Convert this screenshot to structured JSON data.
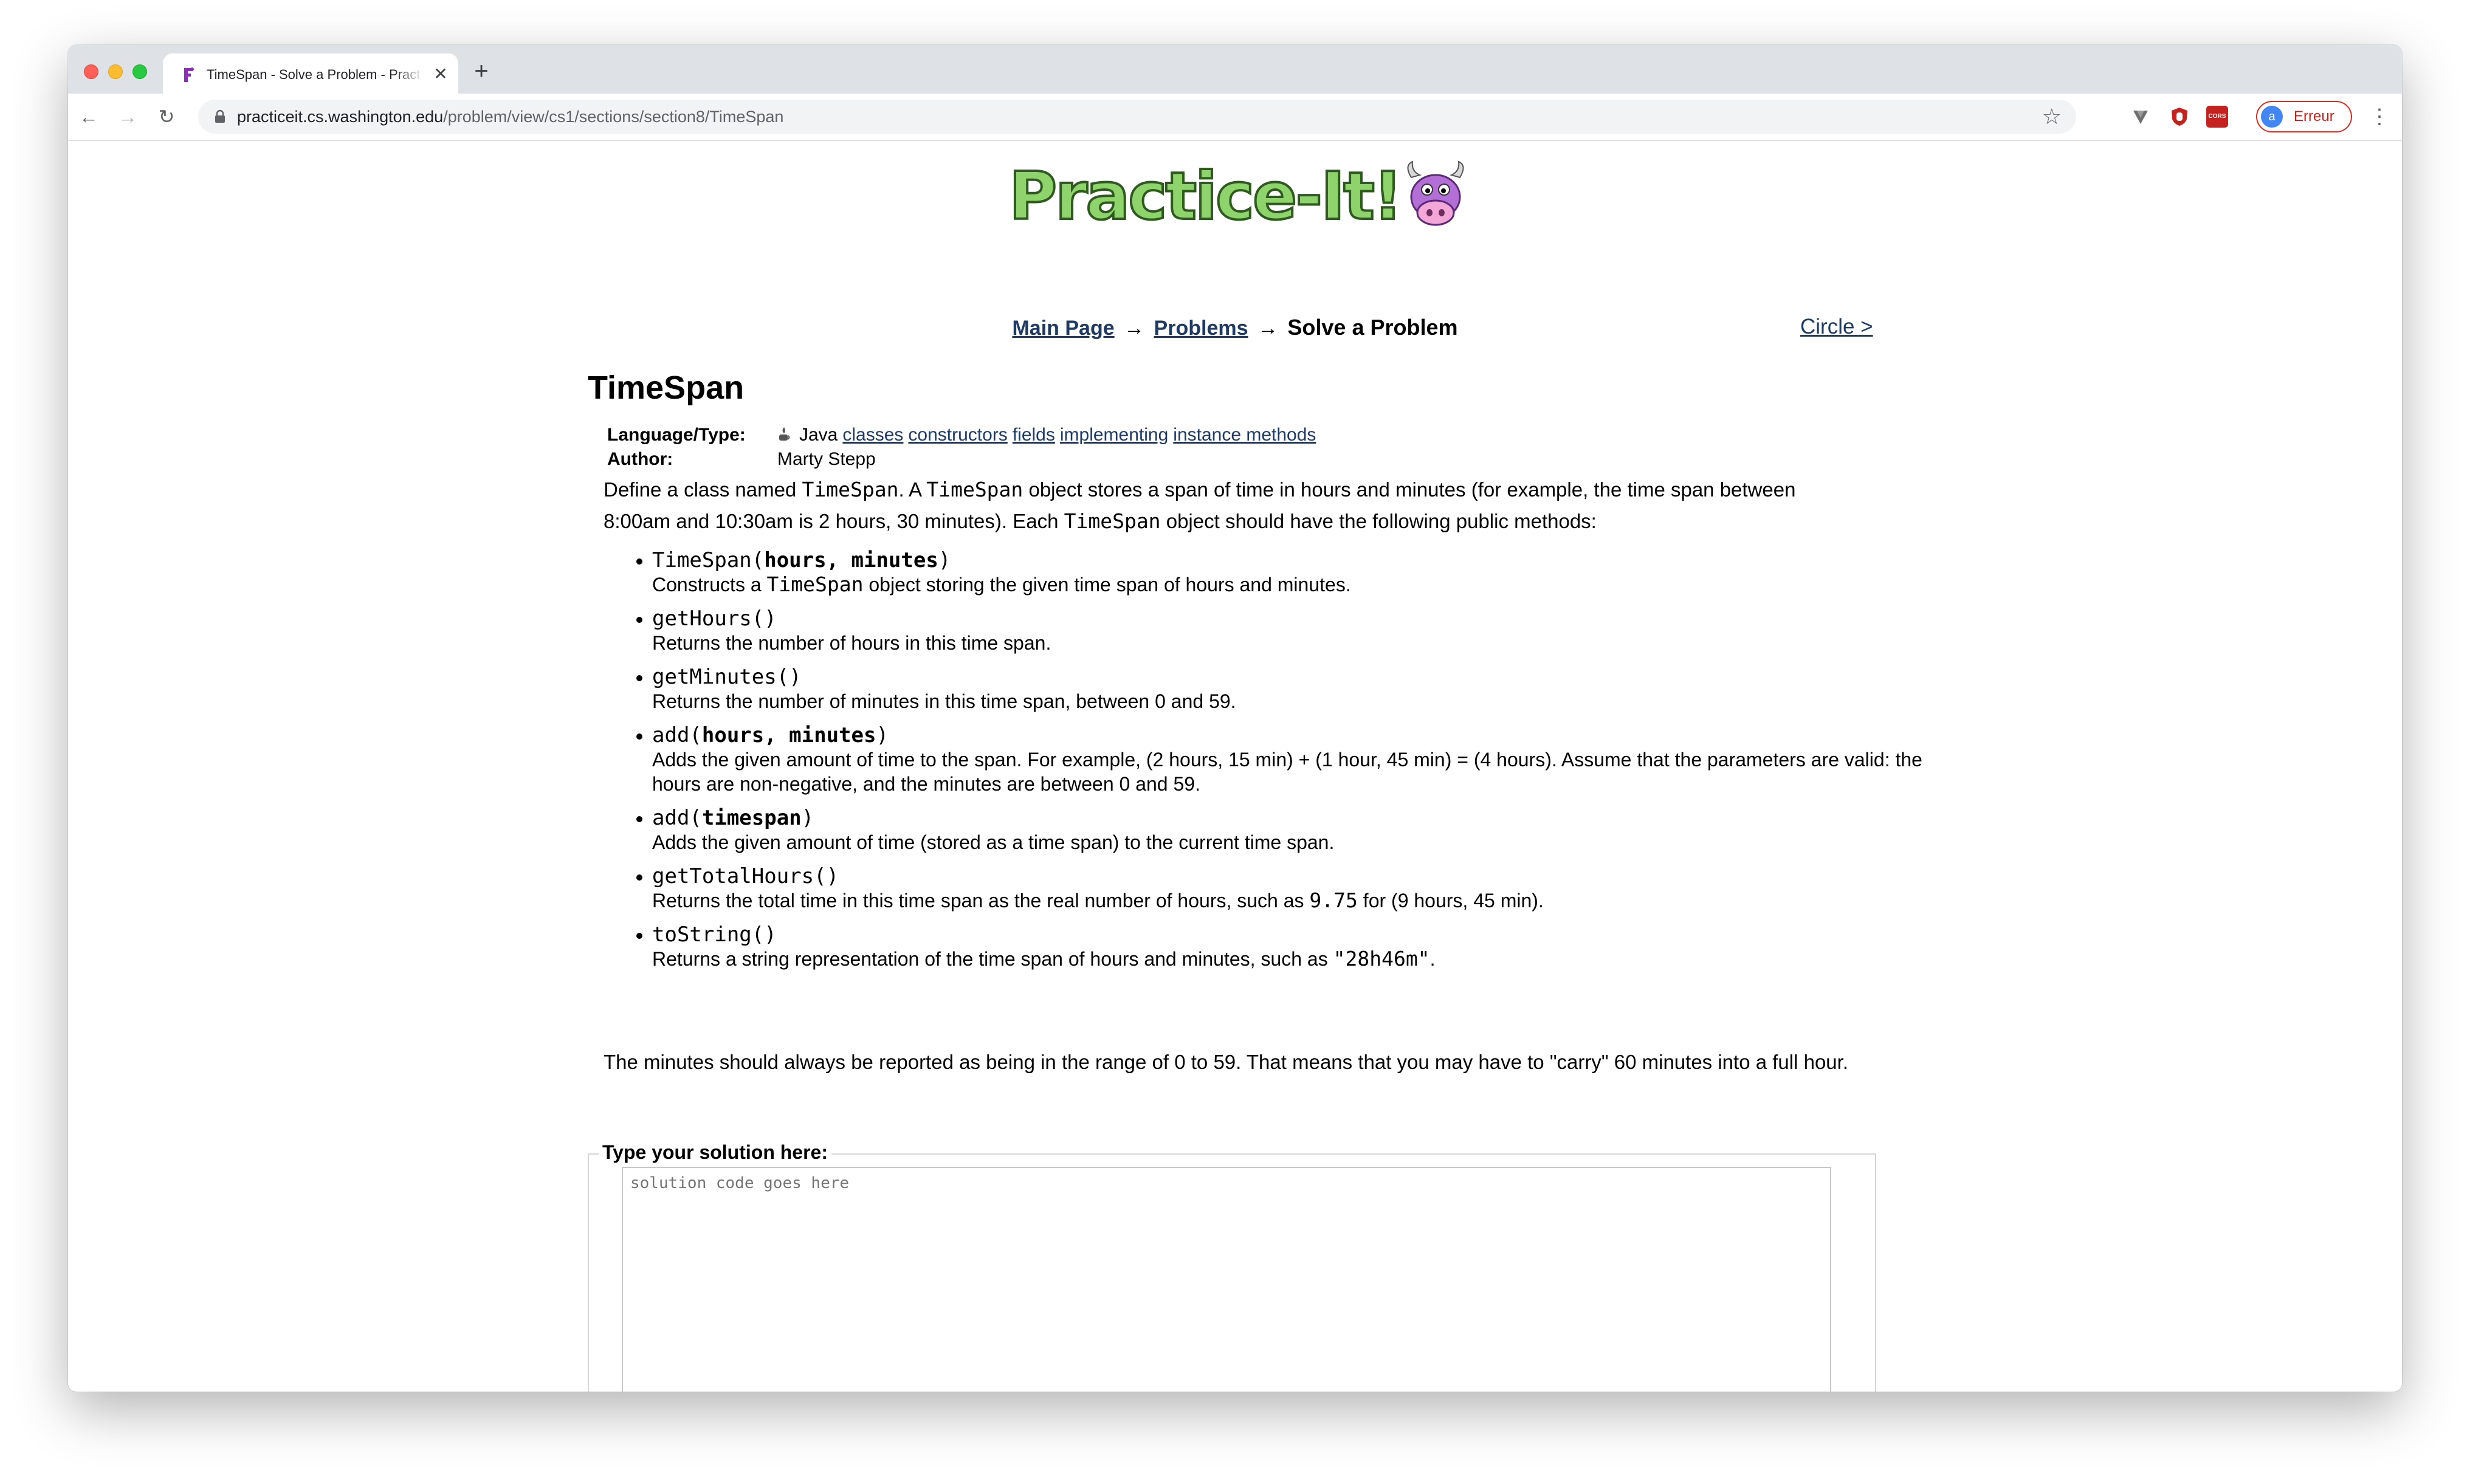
{
  "browser": {
    "tab_title": "TimeSpan - Solve a Problem - Practice-It",
    "tab_close": "✕",
    "new_tab": "+",
    "url_host": "practiceit.cs.washington.edu",
    "url_path": "/problem/view/cs1/sections/section8/TimeSpan",
    "profile_initial": "a",
    "profile_label": "Erreur",
    "ext_label": "CORS"
  },
  "nav": {
    "crumb_main": "Main Page",
    "crumb_problems": "Problems",
    "crumb_sep": "→",
    "crumb_current": "Solve a Problem",
    "circle_link": "Circle >"
  },
  "problem": {
    "title": "TimeSpan",
    "meta_lang_label": "Language/Type:",
    "meta_lang_value": "Java",
    "tags": [
      "classes",
      "constructors",
      "fields",
      "implementing",
      "instance methods"
    ],
    "meta_author_label": "Author:",
    "meta_author_value": "Marty Stepp",
    "desc_1": "Define a class named ",
    "desc_code_1": "TimeSpan",
    "desc_2": ". A ",
    "desc_code_2": "TimeSpan",
    "desc_3": " object stores a span of time in hours and minutes (for example, the time span between 8:00am and 10:30am is 2 hours, 30 minutes). Each ",
    "desc_code_3": "TimeSpan",
    "desc_4": " object should have the following public methods:",
    "methods": [
      {
        "sig_name": "TimeSpan(",
        "sig_params": "hours, minutes",
        "sig_end": ")",
        "d1": "Constructs a ",
        "dcode": "TimeSpan",
        "d2": " object storing the given time span of hours and minutes."
      },
      {
        "sig_name": "getHours()",
        "sig_params": "",
        "sig_end": "",
        "d1": "Returns the number of hours in this time span.",
        "dcode": "",
        "d2": ""
      },
      {
        "sig_name": "getMinutes()",
        "sig_params": "",
        "sig_end": "",
        "d1": "Returns the number of minutes in this time span, between 0 and 59.",
        "dcode": "",
        "d2": ""
      },
      {
        "sig_name": "add(",
        "sig_params": "hours, minutes",
        "sig_end": ")",
        "d1": "Adds the given amount of time to the span. For example, (2 hours, 15 min) + (1 hour, 45 min) = (4 hours). Assume that the parameters are valid: the hours are non-negative, and the minutes are between 0 and 59.",
        "dcode": "",
        "d2": ""
      },
      {
        "sig_name": "add(",
        "sig_params": "timespan",
        "sig_end": ")",
        "d1": "Adds the given amount of time (stored as a time span) to the current time span.",
        "dcode": "",
        "d2": ""
      },
      {
        "sig_name": "getTotalHours()",
        "sig_params": "",
        "sig_end": "",
        "d1": "Returns the total time in this time span as the real number of hours, such as ",
        "dcode": "9.75",
        "d2": " for (9 hours, 45 min)."
      },
      {
        "sig_name": "toString()",
        "sig_params": "",
        "sig_end": "",
        "d1": "Returns a string representation of the time span of hours and minutes, such as ",
        "dcode": "\"28h46m\"",
        "d2": "."
      }
    ],
    "note": "The minutes should always be reported as being in the range of 0 to 59. That means that you may have to \"carry\" 60 minutes into a full hour.",
    "solution_legend": "Type your solution here:",
    "solution_placeholder": "solution code goes here"
  }
}
